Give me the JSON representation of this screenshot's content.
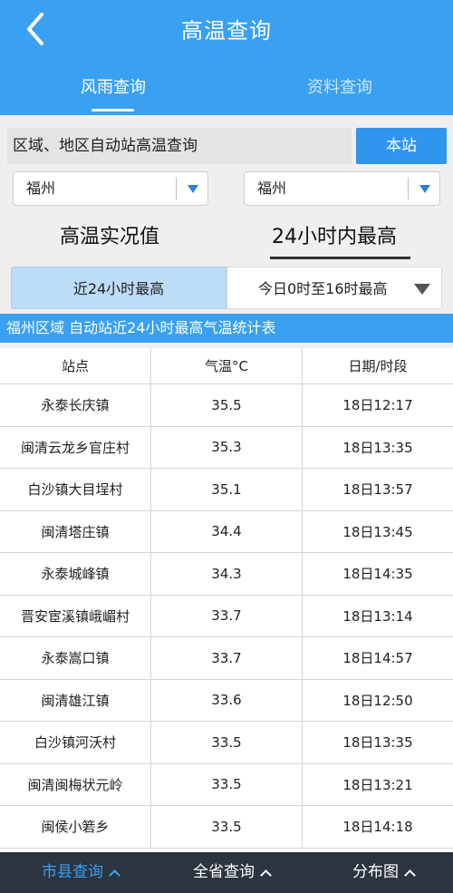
{
  "header": {
    "title": "高温查询",
    "back_icon": "chevron-left-icon",
    "tabs": [
      {
        "label": "风雨查询",
        "active": true
      },
      {
        "label": "资料查询",
        "active": false
      }
    ]
  },
  "search": {
    "label": "区域、地区自动站高温查询",
    "station_button": "本站",
    "region_select": "福州",
    "area_select": "福州"
  },
  "mode_tabs": {
    "left": "高温实况值",
    "right": "24小时内最高"
  },
  "segment": {
    "left": "近24小时最高",
    "right": "今日0时至16时最高"
  },
  "table": {
    "title": "福州区域 自动站近24小时最高气温统计表",
    "headers": [
      "站点",
      "气温°C",
      "日期/时段"
    ],
    "rows": [
      [
        "永泰长庆镇",
        "35.5",
        "18日12:17"
      ],
      [
        "闽清云龙乡官庄村",
        "35.3",
        "18日13:35"
      ],
      [
        "白沙镇大目埕村",
        "35.1",
        "18日13:57"
      ],
      [
        "闽清塔庄镇",
        "34.4",
        "18日13:45"
      ],
      [
        "永泰城峰镇",
        "34.3",
        "18日14:35"
      ],
      [
        "晋安宦溪镇峨嵋村",
        "33.7",
        "18日13:14"
      ],
      [
        "永泰嵩口镇",
        "33.7",
        "18日14:57"
      ],
      [
        "闽清雄江镇",
        "33.6",
        "18日12:50"
      ],
      [
        "白沙镇河沃村",
        "33.5",
        "18日13:35"
      ],
      [
        "闽清闽梅状元岭",
        "33.5",
        "18日13:21"
      ],
      [
        "闽侯小箬乡",
        "33.5",
        "18日14:18"
      ]
    ]
  },
  "bottom_nav": [
    {
      "label": "市县查询",
      "active": true
    },
    {
      "label": "全省查询",
      "active": false
    },
    {
      "label": "分布图",
      "active": false
    }
  ],
  "colors": {
    "primary": "#3aa0f1",
    "button": "#2f95ef",
    "segment_active": "#bcdcf8",
    "bottom_bar": "#2c3440"
  }
}
